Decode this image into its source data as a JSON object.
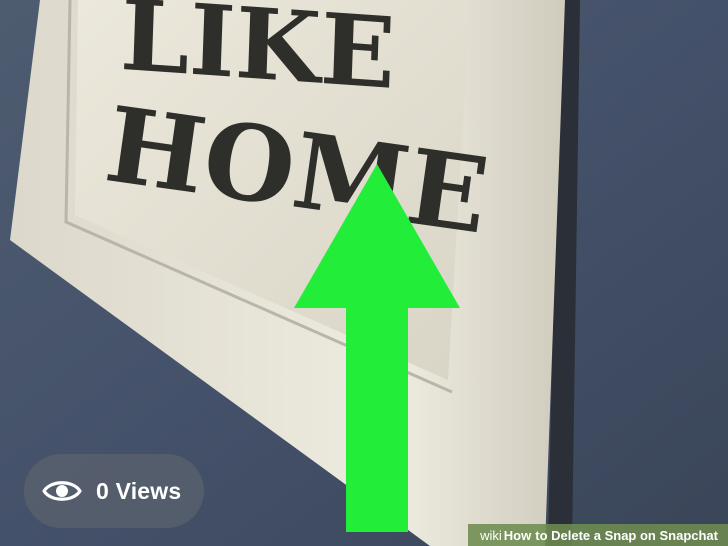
{
  "photo": {
    "sign_text_line1": "LIKE",
    "sign_text_line2": "HOME"
  },
  "views": {
    "icon": "eye-icon",
    "label": "0 Views"
  },
  "annotation": {
    "icon": "arrow-up-icon",
    "color": "#22ee3a"
  },
  "watermark": {
    "brand_prefix": "wiki",
    "brand_how": "How",
    "title": "to Delete a Snap on Snapchat"
  },
  "colors": {
    "wall": "#3f4a59",
    "frame": "#e7e4d8",
    "pill": "#5c626e",
    "arrow": "#22ee3a"
  }
}
